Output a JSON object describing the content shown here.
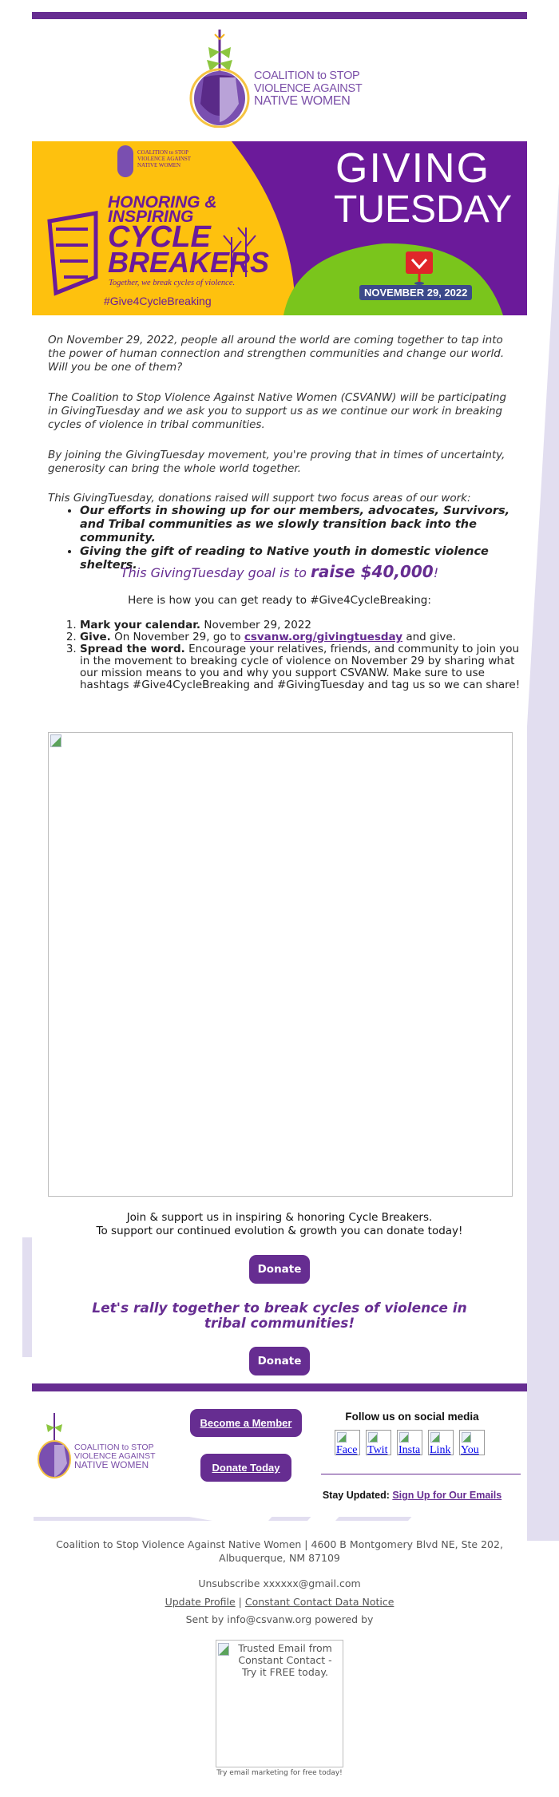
{
  "colors": {
    "brand_purple": "#662d91",
    "banner_yellow": "#fec10e",
    "banner_violet": "#6b1a9a",
    "banner_green": "#7ac51c",
    "date_badge": "#3c4a8a",
    "deco_lavender": "#e2def0"
  },
  "header": {
    "logo_lines": [
      "COALITION to STOP",
      "VIOLENCE AGAINST",
      "NATIVE WOMEN"
    ]
  },
  "banner": {
    "small_logo_lines": [
      "COALITION to STOP",
      "VIOLENCE AGAINST",
      "NATIVE WOMEN"
    ],
    "headline_1": "HONORING &",
    "headline_2": "INSPIRING",
    "headline_3": "CYCLE",
    "headline_4": "BREAKERS",
    "tagline": "Together, we break cycles of violence.",
    "hashtag": "#Give4CycleBreaking",
    "giving_1": "GIVING",
    "giving_2": "TUESDAY",
    "date": "NOVEMBER 29, 2022"
  },
  "intro": {
    "p1": "On November 29, 2022, people all around the world are coming together to tap into the power of human connection and strengthen communities and change our world. Will you be one of them?",
    "p2": "The Coalition to Stop Violence Against Native Women (CSVANW) will be participating in GivingTuesday and we ask you to support us as we continue our work in breaking cycles of violence in tribal communities.",
    "p3": "By joining the GivingTuesday movement, you're proving that in times of uncertainty, generosity can bring the whole world together.",
    "focus_lead": "This GivingTuesday, donations raised will support two focus areas of our work:",
    "focus_items": [
      "Our efforts in showing up for our members, advocates, Survivors, and Tribal communities as we slowly transition back into the community.",
      "Giving the gift of reading to Native youth in domestic violence shelters."
    ]
  },
  "goal": {
    "lead": "This GivingTuesday goal is to ",
    "amount": "raise $40,000",
    "tail": "!"
  },
  "howto": {
    "title": "Here is how you can get ready to #Give4CycleBreaking:",
    "steps": [
      {
        "bold": "Mark your calendar.",
        "text": " November 29, 2022"
      },
      {
        "bold": "Give.",
        "text": " On November 29, go to ",
        "link": "csvanw.org/givingtuesday",
        "after": " and give."
      },
      {
        "bold": "Spread the word.",
        "text": " Encourage your relatives, friends, and community to join you in the movement to breaking cycle of violence on November 29 by sharing what our mission means to you and why you support CSVANW. Make sure to use hashtags #Give4CycleBreaking and #GivingTuesday and tag us so we can share!"
      }
    ]
  },
  "cta": {
    "line1": "Join & support us in inspiring & honoring Cycle Breakers.",
    "line2": "To support our continued evolution & growth you can donate today!",
    "donate": "Donate",
    "rally": "Let's rally together to break cycles of violence in tribal communities!",
    "donate2": "Donate"
  },
  "footer_block": {
    "logo_lines": [
      "COALITION to STOP",
      "VIOLENCE AGAINST",
      "NATIVE WOMEN"
    ],
    "member_btn": "Become a Member",
    "donate_btn": "Donate Today",
    "follow_title": "Follow us on social media",
    "social": [
      "Face",
      "Twit",
      "Insta",
      "Link",
      "You"
    ],
    "stay_label": "Stay Updated: ",
    "stay_link": "Sign Up for Our Emails"
  },
  "legal": {
    "address": "Coalition to Stop Violence Against Native Women | 4600 B Montgomery Blvd NE, Ste 202, Albuquerque, NM 87109",
    "unsubscribe": "Unsubscribe xxxxxx@gmail.com",
    "update_profile": "Update Profile",
    "separator": " | ",
    "data_notice": "Constant Contact Data Notice",
    "sent_by": "Sent by info@csvanw.org powered by",
    "cc_alt": "Trusted Email from Constant Contact - Try it FREE today.",
    "cc_caption": "Try email marketing for free today!"
  }
}
